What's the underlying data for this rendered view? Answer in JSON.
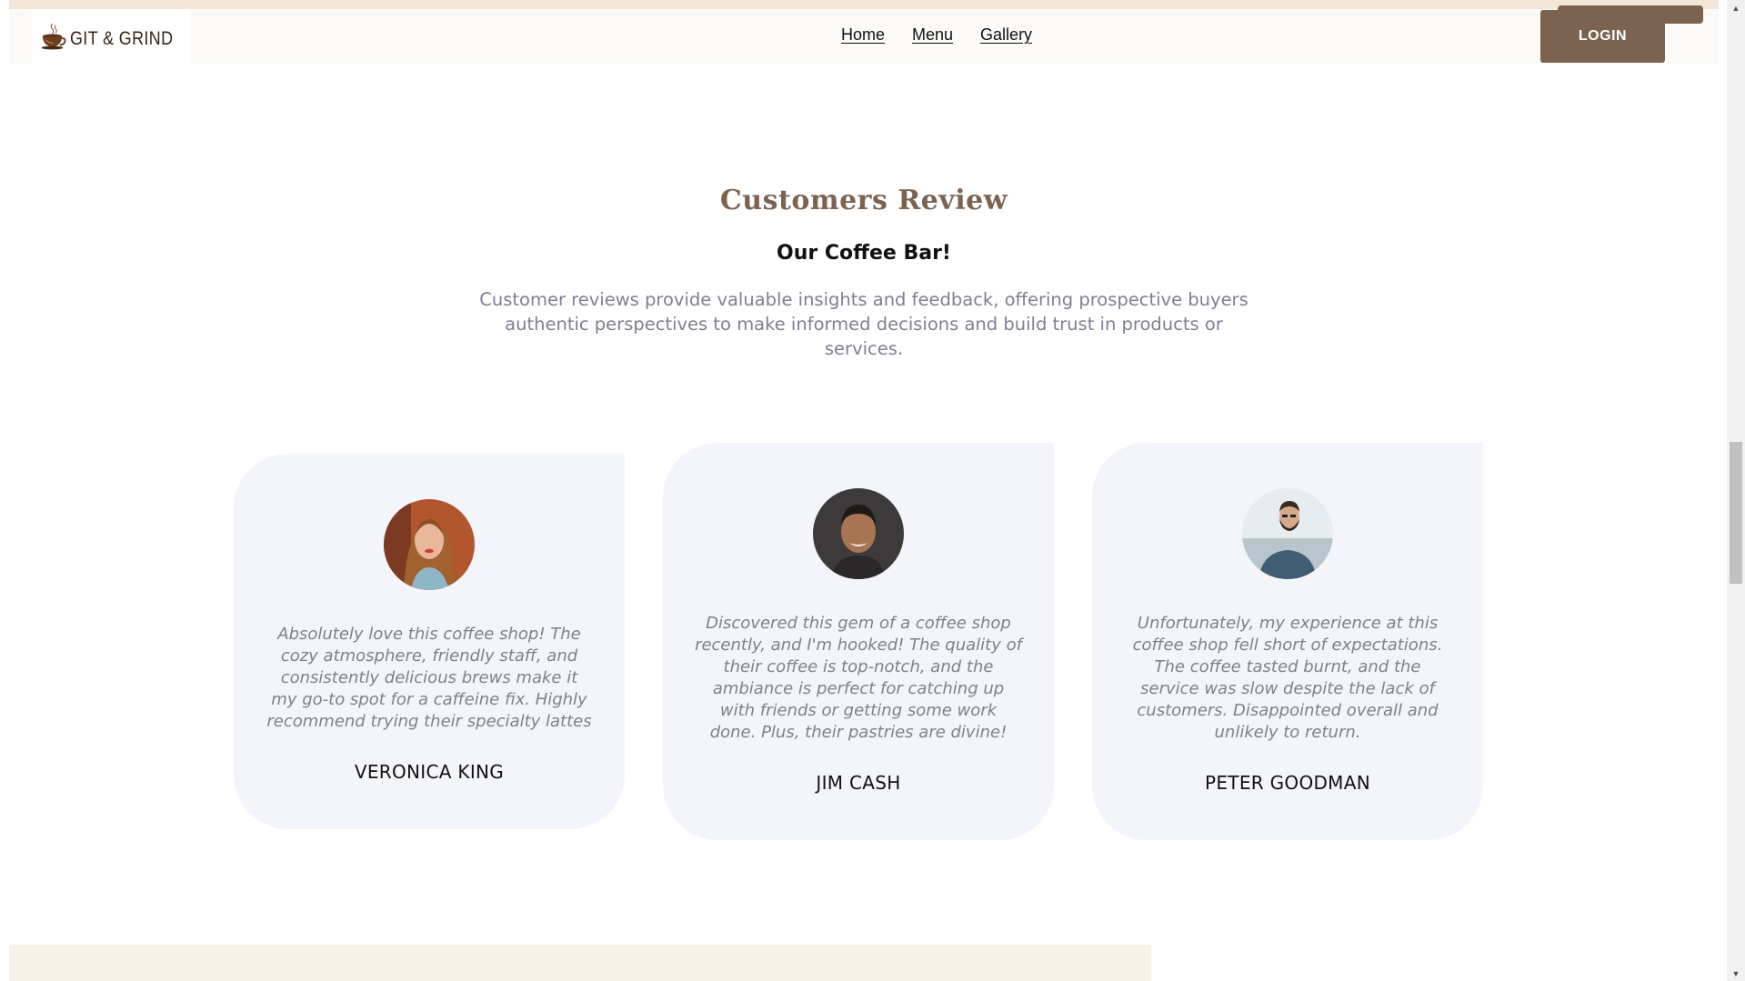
{
  "navbar": {
    "logo_text": "GIT & GRIND",
    "links": [
      "Home",
      "Menu",
      "Gallery"
    ],
    "login_label": "LOGIN"
  },
  "reviews_section": {
    "title": "Customers Review",
    "subtitle": "Our Coffee Bar!",
    "description": "Customer reviews provide valuable insights and feedback, offering prospective buyers authentic perspectives to make informed decisions and build trust in products or services."
  },
  "reviews": [
    {
      "text": "Absolutely love this coffee shop! The cozy atmosphere, friendly staff, and consistently delicious brews make it my go-to spot for a caffeine fix. Highly recommend trying their specialty lattes",
      "name": "VERONICA KING",
      "avatar": "woman-portrait"
    },
    {
      "text": "Discovered this gem of a coffee shop recently, and I'm hooked! The quality of their coffee is top-notch, and the ambiance is perfect for catching up with friends or getting some work done. Plus, their pastries are divine!",
      "name": "JIM CASH",
      "avatar": "man-portrait-smiling"
    },
    {
      "text": "Unfortunately, my experience at this coffee shop fell short of expectations. The coffee tasted burnt, and the service was slow despite the lack of customers. Disappointed overall and unlikely to return.",
      "name": "PETER GOODMAN",
      "avatar": "man-portrait-bearded"
    }
  ],
  "colors": {
    "accent_brown": "#7b6350",
    "card_bg": "#f4f5fa",
    "muted_text": "#7f7f8e",
    "beige": "#f2e6d6"
  }
}
